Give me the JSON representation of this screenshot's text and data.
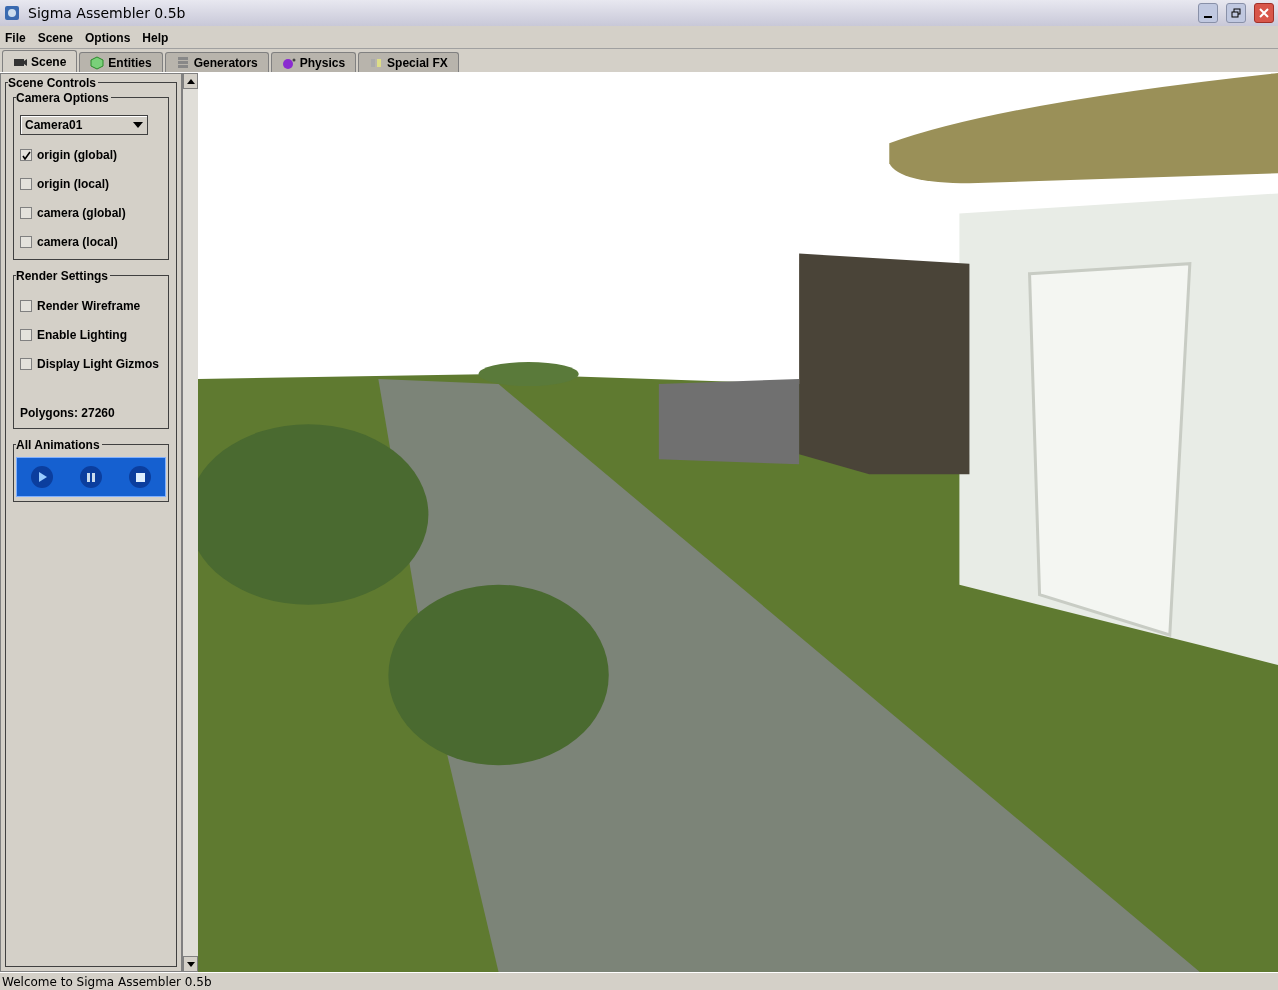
{
  "window": {
    "title": "Sigma Assembler 0.5b"
  },
  "menu": [
    "File",
    "Scene",
    "Options",
    "Help"
  ],
  "tabs": [
    {
      "label": "Scene",
      "selected": true
    },
    {
      "label": "Entities",
      "selected": false
    },
    {
      "label": "Generators",
      "selected": false
    },
    {
      "label": "Physics",
      "selected": false
    },
    {
      "label": "Special FX",
      "selected": false
    }
  ],
  "scene_controls": {
    "title": "Scene Controls",
    "camera_options": {
      "title": "Camera Options",
      "camera": "Camera01",
      "checkboxes": [
        {
          "label": "origin (global)",
          "checked": true
        },
        {
          "label": "origin (local)",
          "checked": false
        },
        {
          "label": "camera (global)",
          "checked": false
        },
        {
          "label": "camera (local)",
          "checked": false
        }
      ]
    },
    "render_settings": {
      "title": "Render Settings",
      "checkboxes": [
        {
          "label": "Render Wireframe",
          "checked": false
        },
        {
          "label": "Enable Lighting",
          "checked": false
        },
        {
          "label": "Display Light Gizmos",
          "checked": false
        }
      ],
      "polygons": "Polygons: 27260"
    },
    "all_animations": {
      "title": "All Animations"
    }
  },
  "status_bar": "Welcome to Sigma Assembler 0.5b"
}
